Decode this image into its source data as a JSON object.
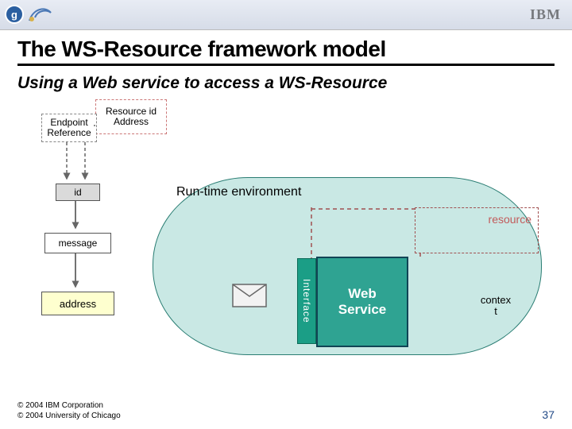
{
  "header": {
    "ibm": "IBM"
  },
  "title": "The WS-Resource framework model",
  "subtitle": "Using a Web service to access a WS-Resource",
  "diagram": {
    "endpoint_ref": "Endpoint Reference",
    "resource_id": "Resource id",
    "address": "Address",
    "id": "id",
    "message": "message",
    "address_box": "address",
    "runtime": "Run-time environment",
    "interface": "Interface",
    "web_service_l1": "Web",
    "web_service_l2": "Service",
    "resource": "resource",
    "context_l1": "contex",
    "context_l2": "t"
  },
  "footer": {
    "copy1": "© 2004 IBM Corporation",
    "copy2": "© 2004 University of Chicago",
    "page": "37"
  }
}
